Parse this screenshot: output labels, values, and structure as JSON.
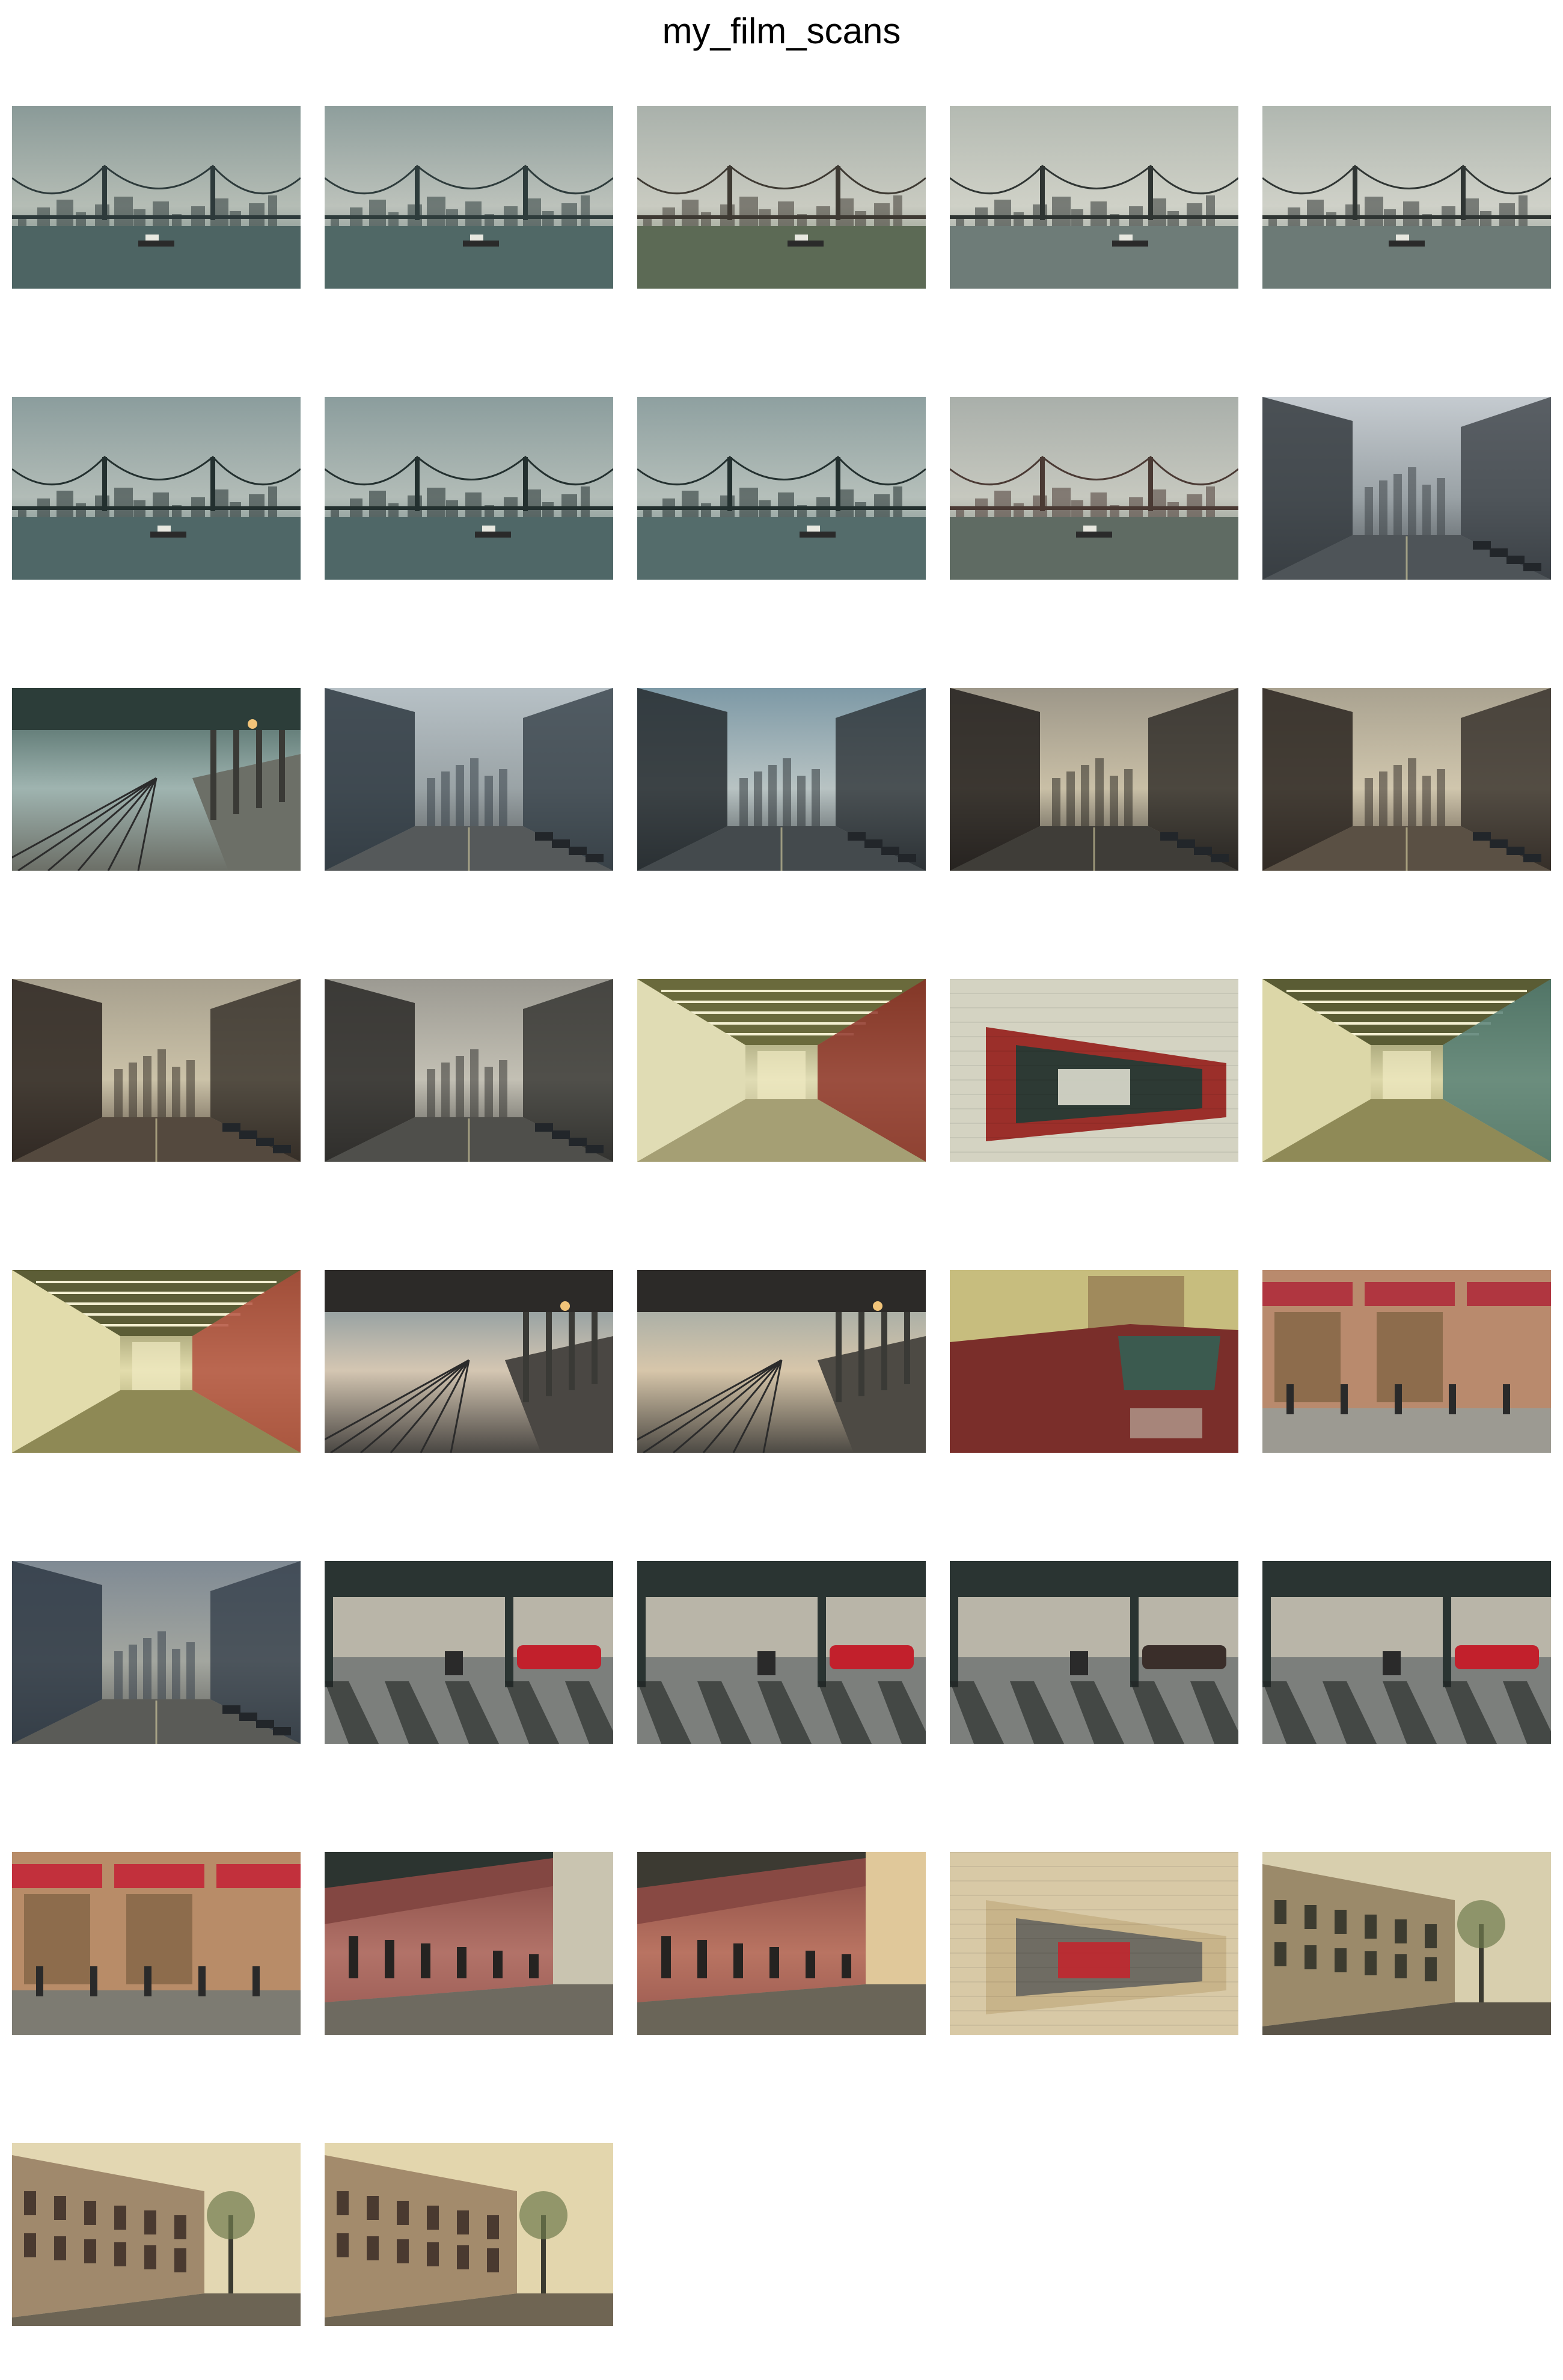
{
  "window": {
    "title": "my_film_scans"
  },
  "gallery": {
    "columns": 5,
    "thumbnails": [
      {
        "scene": "bridge",
        "colors": {
          "sky": "#8a9a98",
          "horizon": "#b5bdb5",
          "ground": "#4d6463",
          "accent": "#2d3a3b"
        }
      },
      {
        "scene": "bridge",
        "colors": {
          "sky": "#8e9e9c",
          "horizon": "#bcc2bb",
          "ground": "#506866",
          "accent": "#2e3c3c"
        }
      },
      {
        "scene": "bridge",
        "colors": {
          "sky": "#a9b1ab",
          "horizon": "#c9cbc1",
          "ground": "#5c6a55",
          "accent": "#3e3a33"
        }
      },
      {
        "scene": "bridge",
        "colors": {
          "sky": "#b4bab2",
          "horizon": "#cfd1c7",
          "ground": "#6e7c78",
          "accent": "#2f3533"
        }
      },
      {
        "scene": "bridge",
        "colors": {
          "sky": "#b0b7b0",
          "horizon": "#cfd1c8",
          "ground": "#6c7a76",
          "accent": "#2f3533"
        }
      },
      {
        "scene": "bridge",
        "colors": {
          "sky": "#8b9d9d",
          "horizon": "#b2bcb7",
          "ground": "#4f6767",
          "accent": "#23302f"
        }
      },
      {
        "scene": "bridge",
        "colors": {
          "sky": "#8b9d9d",
          "horizon": "#b2bcb7",
          "ground": "#4f6767",
          "accent": "#23302f"
        }
      },
      {
        "scene": "bridge",
        "colors": {
          "sky": "#8ea0a0",
          "horizon": "#b5bfba",
          "ground": "#546c6b",
          "accent": "#23302f"
        }
      },
      {
        "scene": "bridge",
        "colors": {
          "sky": "#a9afaa",
          "horizon": "#c6c8bf",
          "ground": "#5f6b63",
          "accent": "#4a3a34"
        }
      },
      {
        "scene": "street",
        "colors": {
          "sky": "#c5cbd0",
          "horizon": "#9aa2a6",
          "ground": "#4e5458",
          "accent": "#353b40"
        }
      },
      {
        "scene": "platform",
        "colors": {
          "sky": "#3d5a55",
          "horizon": "#9fb4b0",
          "ground": "#6c6f67",
          "accent": "#2c3d39"
        }
      },
      {
        "scene": "street",
        "colors": {
          "sky": "#b7c1c6",
          "horizon": "#9aa3a6",
          "ground": "#55595a",
          "accent": "#2f3a42"
        }
      },
      {
        "scene": "street",
        "colors": {
          "sky": "#7d99a6",
          "horizon": "#b8c3c3",
          "ground": "#444a4d",
          "accent": "#262b2f"
        }
      },
      {
        "scene": "street",
        "colors": {
          "sky": "#9d9789",
          "horizon": "#c9bfa6",
          "ground": "#3f3d38",
          "accent": "#221f1c"
        }
      },
      {
        "scene": "street",
        "colors": {
          "sky": "#a9a290",
          "horizon": "#d0c6ad",
          "ground": "#5a5044",
          "accent": "#2a2420"
        }
      },
      {
        "scene": "street",
        "colors": {
          "sky": "#a7a08e",
          "horizon": "#cbc2a8",
          "ground": "#54493e",
          "accent": "#2b2520"
        }
      },
      {
        "scene": "street",
        "colors": {
          "sky": "#9c9a92",
          "horizon": "#c3c0b4",
          "ground": "#4f4f4b",
          "accent": "#2a2927"
        }
      },
      {
        "scene": "tunnel",
        "colors": {
          "sky": "#6a6a3c",
          "horizon": "#e0dcb4",
          "ground": "#a59f74",
          "accent": "#8a2b22"
        }
      },
      {
        "scene": "sign",
        "colors": {
          "sky": "#d4d3c2",
          "horizon": "#9b2f2a",
          "ground": "#2d3a34",
          "accent": "#e8e6d8"
        }
      },
      {
        "scene": "tunnel",
        "colors": {
          "sky": "#5a5c34",
          "horizon": "#dcd7a8",
          "ground": "#8f8a57",
          "accent": "#4f7a73"
        }
      },
      {
        "scene": "tunnel",
        "colors": {
          "sky": "#5c5d36",
          "horizon": "#e2dcac",
          "ground": "#8e8955",
          "accent": "#b04a3a"
        }
      },
      {
        "scene": "platform",
        "colors": {
          "sky": "#6f8a98",
          "horizon": "#d4c6b2",
          "ground": "#4a4743",
          "accent": "#2c2a28"
        }
      },
      {
        "scene": "platform",
        "colors": {
          "sky": "#8da0a4",
          "horizon": "#d7c6aa",
          "ground": "#4d4a44",
          "accent": "#2c2a28"
        }
      },
      {
        "scene": "truck",
        "colors": {
          "sky": "#c7bd7e",
          "horizon": "#a08a5c",
          "ground": "#7a2e2a",
          "accent": "#3b5a4f"
        }
      },
      {
        "scene": "storefront",
        "colors": {
          "sky": "#d8d2c2",
          "horizon": "#b98a6d",
          "ground": "#9c9a92",
          "accent": "#b03640"
        }
      },
      {
        "scene": "street",
        "colors": {
          "sky": "#7f8a94",
          "horizon": "#a3a69f",
          "ground": "#5a5b57",
          "accent": "#2f3a45"
        }
      },
      {
        "scene": "underpass",
        "colors": {
          "sky": "#2a3432",
          "horizon": "#b9b5a8",
          "ground": "#7c7f7c",
          "accent": "#c2202c"
        }
      },
      {
        "scene": "underpass",
        "colors": {
          "sky": "#2a3432",
          "horizon": "#b9b5a8",
          "ground": "#7c7f7c",
          "accent": "#c2202c"
        }
      },
      {
        "scene": "underpass",
        "colors": {
          "sky": "#2a3432",
          "horizon": "#b9b5a8",
          "ground": "#7c7f7c",
          "accent": "#3a2e2a"
        }
      },
      {
        "scene": "underpass",
        "colors": {
          "sky": "#2a3432",
          "horizon": "#b9b5a8",
          "ground": "#7c7f7c",
          "accent": "#c2202c"
        }
      },
      {
        "scene": "storefront",
        "colors": {
          "sky": "#e7e1d4",
          "horizon": "#b88c68",
          "ground": "#7d7b72",
          "accent": "#c2303c"
        }
      },
      {
        "scene": "sidewalk",
        "colors": {
          "sky": "#2c3430",
          "horizon": "#c9c4b0",
          "ground": "#6e6a60",
          "accent": "#a8504a"
        }
      },
      {
        "scene": "sidewalk",
        "colors": {
          "sky": "#3c3a32",
          "horizon": "#e0c89a",
          "ground": "#6a6558",
          "accent": "#a8504a"
        }
      },
      {
        "scene": "sign",
        "colors": {
          "sky": "#d8c9a6",
          "horizon": "#c8b48a",
          "ground": "#6f6c63",
          "accent": "#c7222a"
        }
      },
      {
        "scene": "rowhouse",
        "colors": {
          "sky": "#d8cfae",
          "horizon": "#9b8a6a",
          "ground": "#5a5448",
          "accent": "#3d3c30"
        }
      },
      {
        "scene": "rowhouse",
        "colors": {
          "sky": "#e3d7b2",
          "horizon": "#a0896c",
          "ground": "#6c6454",
          "accent": "#4a3a30"
        }
      },
      {
        "scene": "rowhouse",
        "colors": {
          "sky": "#e3d6ad",
          "horizon": "#a38b6c",
          "ground": "#6f6553",
          "accent": "#4a3a30"
        }
      }
    ]
  }
}
